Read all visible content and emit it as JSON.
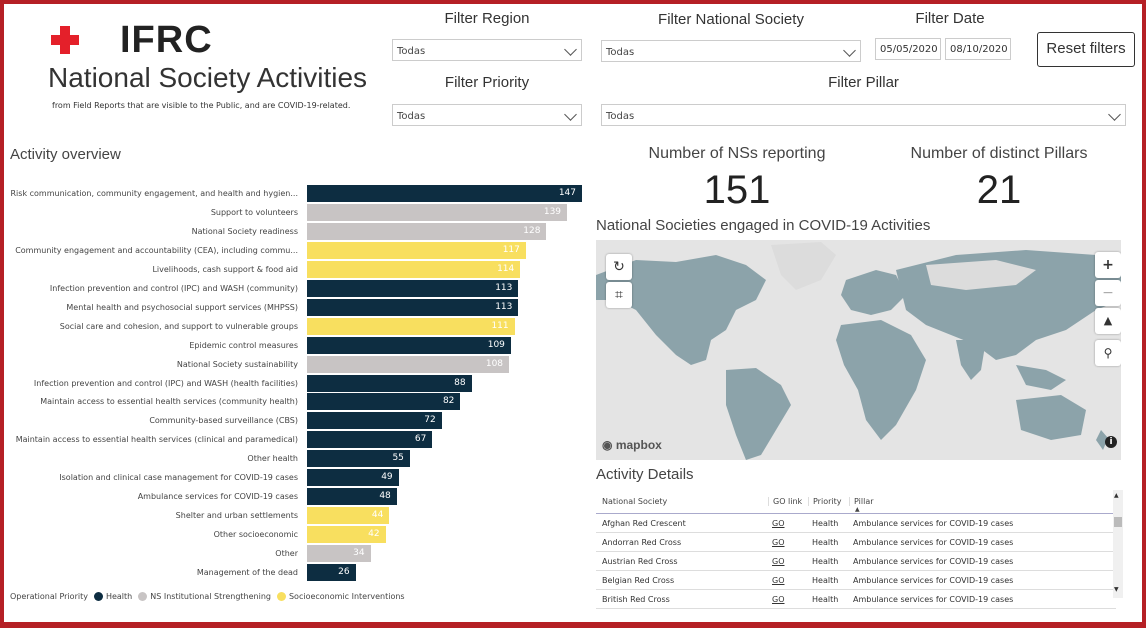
{
  "brand": {
    "logo_text": "IFRC",
    "title": "National Society Activities",
    "subtitle": "from Field Reports that are visible to the Public, and are COVID-19-related."
  },
  "filters": {
    "region_label": "Filter Region",
    "region_value": "Todas",
    "ns_label": "Filter National Society",
    "ns_value": "Todas",
    "date_label": "Filter Date",
    "date_from": "05/05/2020",
    "date_to": "08/10/2020",
    "priority_label": "Filter Priority",
    "priority_value": "Todas",
    "pillar_label": "Filter Pillar",
    "pillar_value": "Todas",
    "reset_label": "Reset filters"
  },
  "overview": {
    "title": "Activity overview"
  },
  "kpis": {
    "ns_label": "Number of NSs reporting",
    "ns_value": "151",
    "pillars_label": "Number of distinct Pillars",
    "pillars_value": "21"
  },
  "map": {
    "title": "National Societies engaged in COVID-19 Activities",
    "attribution": "mapbox",
    "info_icon": "info-icon"
  },
  "legend": {
    "title": "Operational Priority",
    "items": [
      {
        "label": "Health",
        "color": "#0d2d41"
      },
      {
        "label": "NS Institutional Strengthening",
        "color": "#c8c4c4"
      },
      {
        "label": "Socioeconomic Interventions",
        "color": "#f8df5f"
      }
    ]
  },
  "colors": {
    "health": "#0d2d41",
    "ns": "#c8c4c4",
    "socio": "#f8df5f"
  },
  "chart_data": {
    "type": "bar",
    "orientation": "horizontal",
    "categories": [
      "Risk communication, community engagement, and health and hygien...",
      "Support to volunteers",
      "National Society readiness",
      "Community engagement and accountability (CEA), including commu...",
      "Livelihoods, cash support & food aid",
      "Infection prevention and control (IPC) and WASH (community)",
      "Mental health and psychosocial support services (MHPSS)",
      "Social care and cohesion, and support to vulnerable groups",
      "Epidemic control measures",
      "National Society sustainability",
      "Infection prevention and control (IPC) and WASH (health facilities)",
      "Maintain access to essential health services (community health)",
      "Community-based surveillance (CBS)",
      "Maintain access to essential health services (clinical and paramedical)",
      "Other health",
      "Isolation and clinical case management for COVID-19 cases",
      "Ambulance services for COVID-19 cases",
      "Shelter and urban settlements",
      "Other socioeconomic",
      "Other",
      "Management of the dead"
    ],
    "values": [
      147,
      139,
      128,
      117,
      114,
      113,
      113,
      111,
      109,
      108,
      88,
      82,
      72,
      67,
      55,
      49,
      48,
      44,
      42,
      34,
      26
    ],
    "priority": [
      "health",
      "ns",
      "ns",
      "socio",
      "socio",
      "health",
      "health",
      "socio",
      "health",
      "ns",
      "health",
      "health",
      "health",
      "health",
      "health",
      "health",
      "health",
      "socio",
      "socio",
      "ns",
      "health"
    ],
    "xlim": [
      0,
      147
    ]
  },
  "details": {
    "title": "Activity Details",
    "columns": [
      "National Society",
      "GO link",
      "Priority",
      "Pillar"
    ],
    "rows": [
      [
        "Afghan Red Crescent",
        "GO",
        "Health",
        "Ambulance services for COVID-19 cases"
      ],
      [
        "Andorran Red Cross",
        "GO",
        "Health",
        "Ambulance services for COVID-19 cases"
      ],
      [
        "Austrian Red Cross",
        "GO",
        "Health",
        "Ambulance services for COVID-19 cases"
      ],
      [
        "Belgian Red Cross",
        "GO",
        "Health",
        "Ambulance services for COVID-19 cases"
      ],
      [
        "British Red Cross",
        "GO",
        "Health",
        "Ambulance services for COVID-19 cases"
      ]
    ]
  }
}
